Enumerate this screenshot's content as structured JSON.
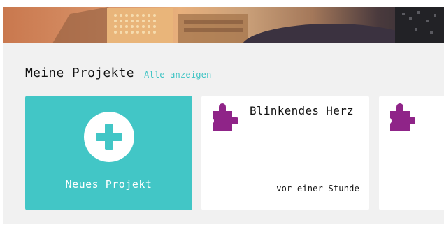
{
  "projects_section": {
    "title": "Meine Projekte",
    "see_all_label": "Alle anzeigen"
  },
  "new_project": {
    "label": "Neues Projekt",
    "icon": "plus-icon"
  },
  "projects": [
    {
      "name": "Blinkendes Herz",
      "time": "vor einer Stunde",
      "icon": "puzzle-icon"
    },
    {
      "name": "",
      "time": "",
      "icon": "puzzle-icon"
    }
  ],
  "colors": {
    "accent": "#42c6c6",
    "link": "#3fc4c4",
    "puzzle": "#8f2488",
    "background": "#f1f1f1"
  }
}
